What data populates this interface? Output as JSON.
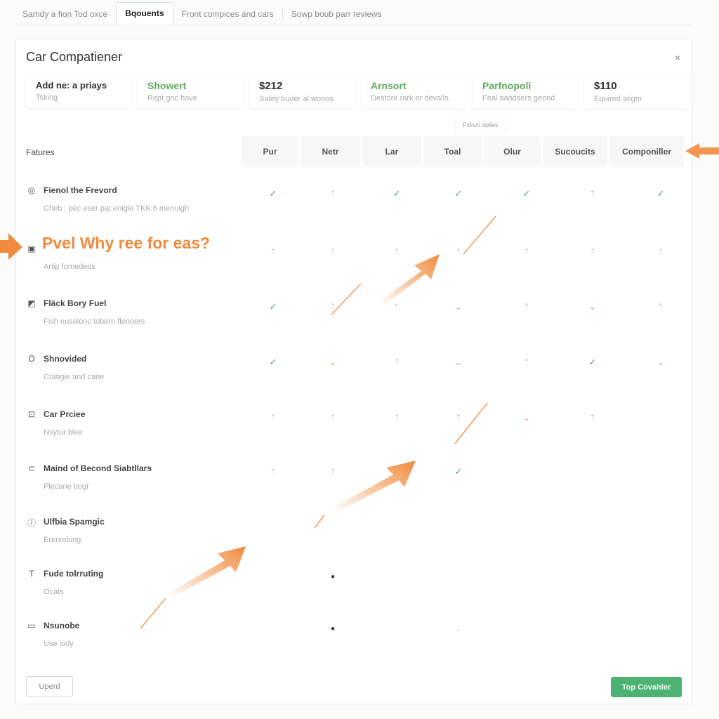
{
  "tabs": [
    {
      "label": "Samdy a fion Tod oxce",
      "active": false
    },
    {
      "label": "Bqouents",
      "active": true
    },
    {
      "label": "Front compices and cars",
      "active": false
    },
    {
      "label": "Sowp boub parr reviews",
      "active": false
    }
  ],
  "panel": {
    "title": "Car Compatiener",
    "close_icon": "×"
  },
  "cards": [
    {
      "title": "Add ne: a priays",
      "subtitle": "Tsking",
      "style": "dark"
    },
    {
      "title": "Showert",
      "subtitle": "Rept gnc have",
      "style": "green"
    },
    {
      "title": "$212",
      "subtitle": "Safey buder al wonos",
      "style": "price"
    },
    {
      "title": "Arnsort",
      "subtitle": "Destore rark or devalls.",
      "style": "green"
    },
    {
      "title": "Parfnopoli",
      "subtitle": "Feal aandsers geond",
      "style": "green"
    },
    {
      "title": "$110",
      "subtitle": "Equired atigm",
      "style": "price"
    }
  ],
  "filter_chip": "Fxlruti dolies",
  "table": {
    "features_label": "Fatures",
    "columns": [
      "Pur",
      "Netr",
      "Lar",
      "Toal",
      "Olur",
      "Sucoucits",
      "Componiller"
    ],
    "rows": [
      {
        "icon": "target-icon",
        "glyph": "◎",
        "title": "Fienol the Frevord",
        "subtitle": "Cheb ; pec eser pat enigle TKK 6 menuigh",
        "marks": [
          "check",
          "grey",
          "check",
          "check",
          "check",
          "grey",
          "check"
        ]
      },
      {
        "icon": "square-icon",
        "glyph": "▣",
        "title": "Pvel Why ree for eas?",
        "subtitle": "Artip fomededs",
        "highlight": true,
        "marks": [
          "grey",
          "grey",
          "grey",
          "grey",
          "grey",
          "grey",
          "grey"
        ]
      },
      {
        "icon": "flag-icon",
        "glyph": "◩",
        "title": "Fläck Bory Fuel",
        "subtitle": "Fish eusalonc tobern flenoers",
        "marks": [
          "check",
          "grey",
          "grey",
          "orange",
          "grey",
          "orange",
          "grey"
        ]
      },
      {
        "icon": "stopwatch-icon",
        "glyph": "Ö",
        "title": "Shnovided",
        "subtitle": "Cratigie and cane",
        "marks": [
          "check",
          "orange",
          "grey",
          "orange",
          "grey",
          "check",
          "orange"
        ]
      },
      {
        "icon": "dot-square-icon",
        "glyph": "⊡",
        "title": "Car Prciee",
        "subtitle": "Nsytur blee",
        "marks": [
          "grey",
          "grey",
          "grey",
          "grey",
          "orange",
          "grey",
          ""
        ]
      },
      {
        "icon": "back-square-icon",
        "glyph": "⊂",
        "title": "Maind of Becond Siabtllars",
        "subtitle": "Plecane bogr",
        "marks": [
          "grey",
          "grey",
          "",
          "check",
          "",
          "",
          ""
        ]
      },
      {
        "icon": "info-circle-icon",
        "glyph": "ⓘ",
        "title": "Ulfbia Spamgic",
        "subtitle": "Eurnmbing",
        "marks": [
          "",
          "",
          "",
          "",
          "",
          "",
          ""
        ]
      },
      {
        "icon": "text-icon",
        "glyph": "T",
        "title": "Fude tolrruting",
        "subtitle": "Ocats",
        "marks": [
          "",
          "dot",
          "",
          "",
          "",
          "",
          ""
        ]
      },
      {
        "icon": "tray-icon",
        "glyph": "▭",
        "title": "Nsunobe",
        "subtitle": "Use lody",
        "marks": [
          "",
          "dot",
          "",
          "greycheck",
          "",
          "",
          ""
        ]
      }
    ]
  },
  "buttons": {
    "left": "Uperd",
    "right": "Top Covahler"
  },
  "colors": {
    "accent_orange": "#f08a3c",
    "check_green": "#5c9f68",
    "button_green": "#4db374",
    "card_green": "#5fa95f"
  }
}
